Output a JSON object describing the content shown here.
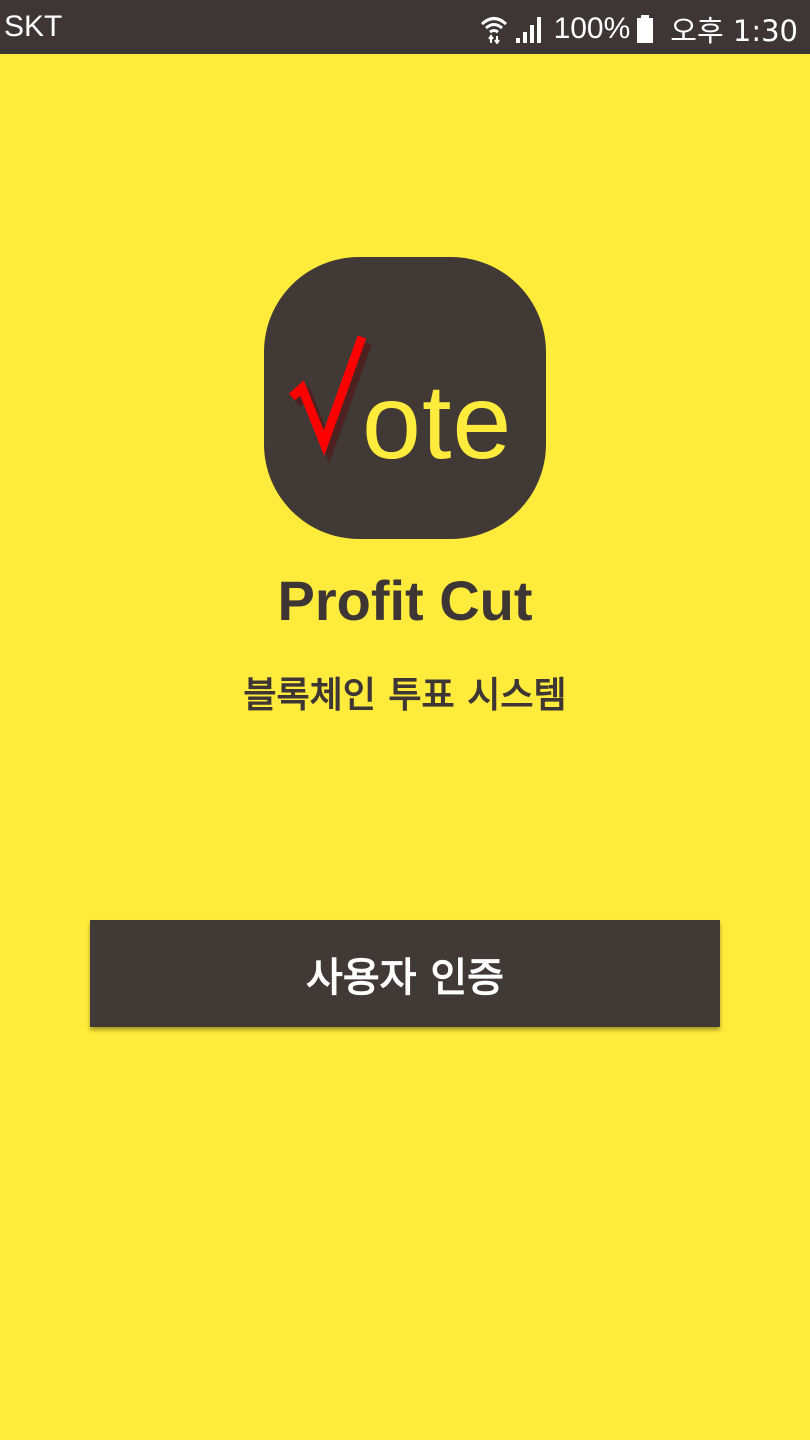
{
  "status_bar": {
    "carrier": "SKT",
    "icons": [
      "wifi-icon",
      "signal-icon",
      "battery-icon"
    ],
    "battery_percent": "100%",
    "time": "오후 1:30"
  },
  "app_icon": {
    "check_mark": "√",
    "word": "ote",
    "check_color": "#ff0000",
    "word_color": "#ffeb3b",
    "background": "#413935"
  },
  "app_name": "Profit Cut",
  "subtitle": "블록체인 투표 시스템",
  "auth_button": {
    "label": "사용자 인증"
  },
  "colors": {
    "background": "#ffeb3b",
    "brand_dark": "#3e3634"
  }
}
